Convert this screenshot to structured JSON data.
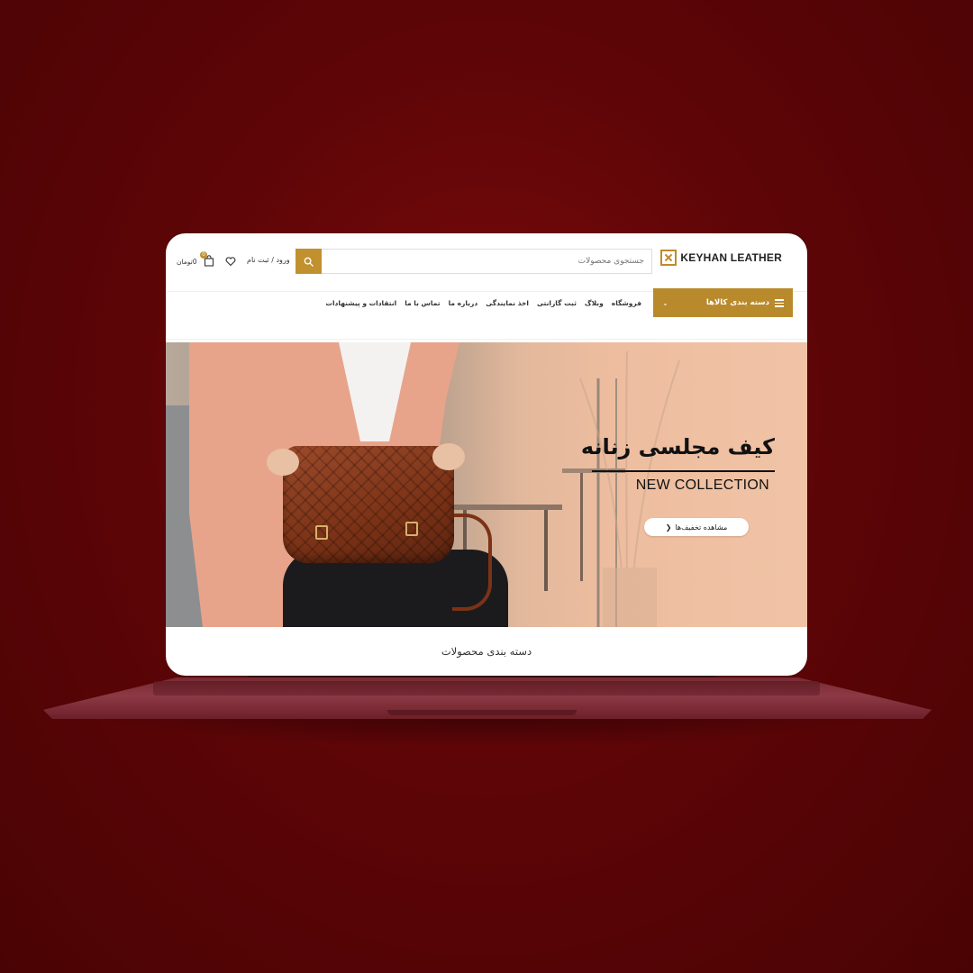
{
  "header": {
    "logo_text": "KEYHAN LEATHER",
    "search_placeholder": "جستجوی محصولات",
    "login_label": "ورود / ثبت نام",
    "cart_count": "0",
    "cart_total": "0تومان"
  },
  "nav": {
    "categories_label": "دسته بندی کالاها",
    "items": [
      "فروشگاه",
      "وبلاگ",
      "ثبت گارانتی",
      "اخذ نمایندگی",
      "درباره ما",
      "تماس با ما",
      "انتقادات و پیشنهادات"
    ]
  },
  "hero": {
    "title": "کیف مجلسی زنانه",
    "subtitle": "NEW COLLECTION",
    "button_label": "مشاهده تخفیف‌ها"
  },
  "section": {
    "title": "دسته بندی محصولات"
  },
  "colors": {
    "background": "#5e0507",
    "accent": "#c1902f",
    "hero_bg": "#eebd9f"
  },
  "icons": [
    "search-icon",
    "heart-icon",
    "cart-icon",
    "hamburger-icon",
    "chevron-down-icon",
    "chevron-left-icon"
  ]
}
